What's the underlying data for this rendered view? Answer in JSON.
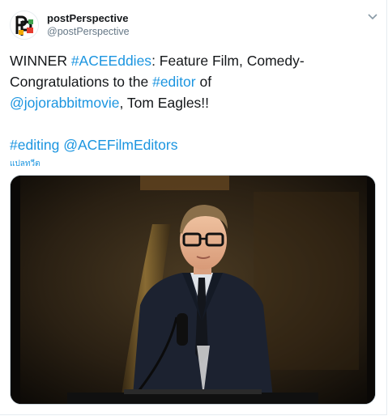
{
  "tweet": {
    "display_name": "postPerspective",
    "handle": "@postPerspective",
    "lines": [
      [
        {
          "t": "WINNER ",
          "link": false
        },
        {
          "t": "#ACEEddies",
          "link": true
        },
        {
          "t": ": Feature Film, Comedy-",
          "link": false
        }
      ],
      [
        {
          "t": "Congratulations to the ",
          "link": false
        },
        {
          "t": "#editor",
          "link": true
        },
        {
          "t": " of",
          "link": false
        }
      ],
      [
        {
          "t": "@jojorabbitmovie",
          "link": true
        },
        {
          "t": ", Tom Eagles!!",
          "link": false
        }
      ],
      [],
      [
        {
          "t": " ",
          "link": false
        },
        {
          "t": "#editing",
          "link": true
        },
        {
          "t": " ",
          "link": false
        },
        {
          "t": "@ACEFilmEditors",
          "link": true
        }
      ]
    ],
    "translate_label": "แปลทวีต",
    "media_alt_subject": "man-at-podium"
  },
  "icons": {
    "avatar": "postperspective-logo",
    "menu": "chevron-down-icon"
  },
  "colors": {
    "link": "#1b95e0",
    "text": "#14171a",
    "secondary": "#657786"
  }
}
